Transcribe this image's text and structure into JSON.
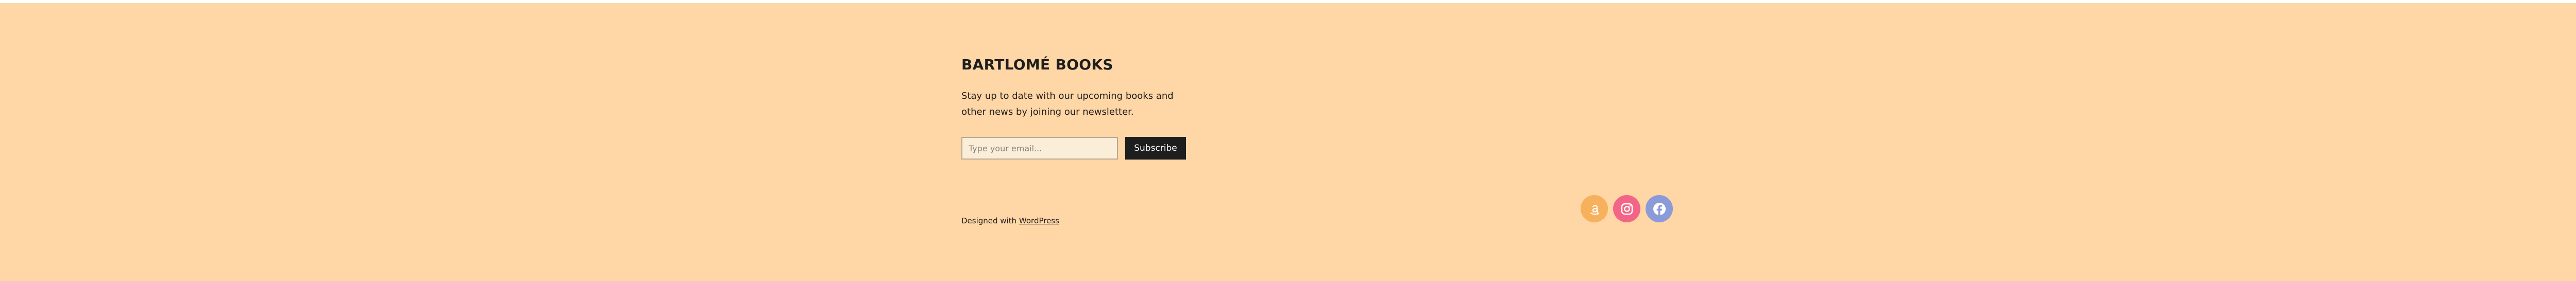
{
  "footer": {
    "brand_title": "BARTLOMÉ BOOKS",
    "blurb": "Stay up to date with our upcoming books and other news by joining our newsletter.",
    "newsletter": {
      "email_placeholder": "Type your email...",
      "email_value": "",
      "subscribe_label": "Subscribe"
    },
    "credit": {
      "prefix": "Designed with ",
      "link_label": "WordPress"
    },
    "social": [
      {
        "name": "Amazon",
        "icon": "amazon-icon",
        "color": "#f7b05b"
      },
      {
        "name": "Instagram",
        "icon": "instagram-icon",
        "color": "#f36586"
      },
      {
        "name": "Facebook",
        "icon": "facebook-icon",
        "color": "#8b9ad8"
      }
    ]
  },
  "colors": {
    "page_background": "#ffd6a5",
    "text": "#1e1e1e",
    "button_background": "#1e1e1e",
    "button_text": "#ffffff",
    "input_background": "#fbeed9"
  }
}
